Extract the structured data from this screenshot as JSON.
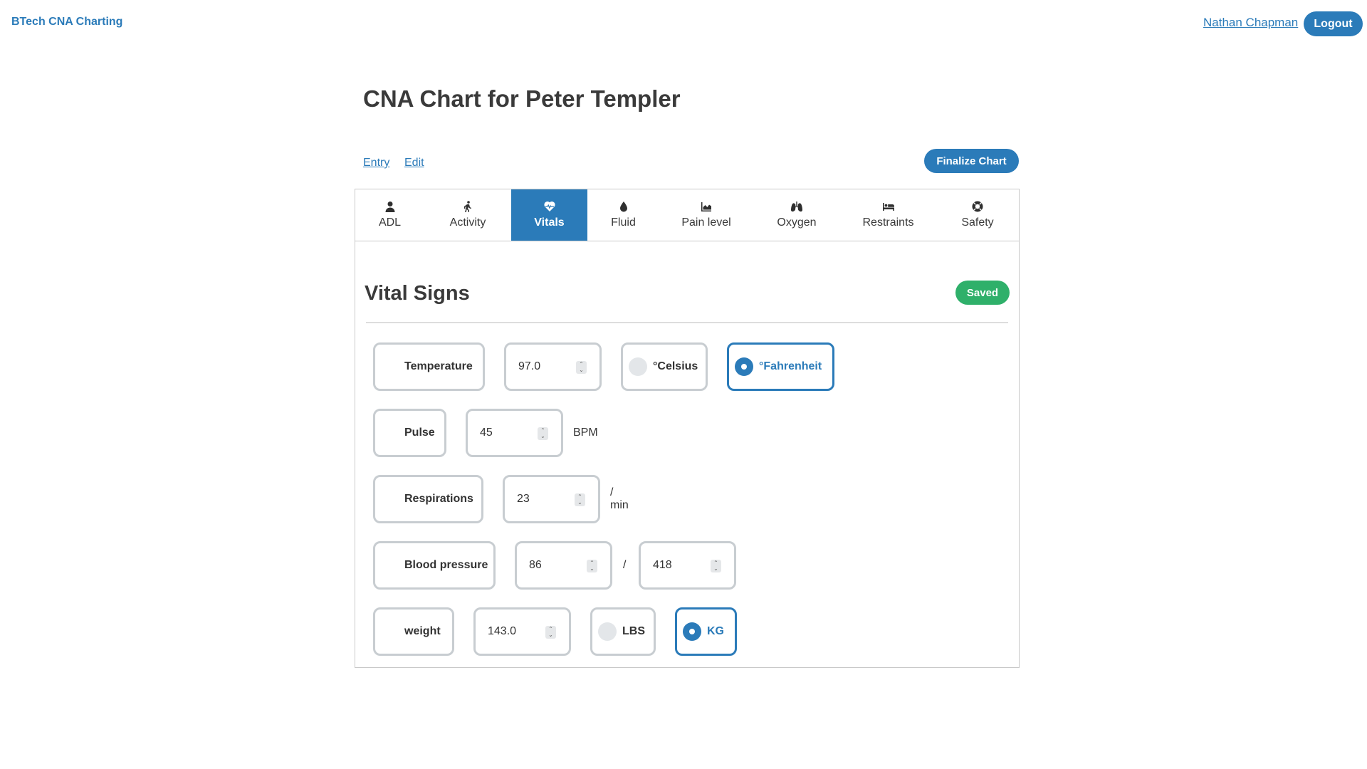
{
  "nav": {
    "brand": "BTech CNA Charting",
    "user": "Nathan Chapman",
    "logout": "Logout"
  },
  "page": {
    "title": "CNA Chart for Peter Templer"
  },
  "modes": {
    "entry": "Entry",
    "edit": "Edit"
  },
  "actions": {
    "finalize": "Finalize Chart"
  },
  "tabs": [
    {
      "label": "ADL",
      "icon": "user-icon"
    },
    {
      "label": "Activity",
      "icon": "walking-icon"
    },
    {
      "label": "Vitals",
      "icon": "heartbeat-icon",
      "active": true
    },
    {
      "label": "Fluid",
      "icon": "droplet-icon"
    },
    {
      "label": "Pain level",
      "icon": "area-chart-icon"
    },
    {
      "label": "Oxygen",
      "icon": "lungs-icon"
    },
    {
      "label": "Restraints",
      "icon": "bed-icon"
    },
    {
      "label": "Safety",
      "icon": "life-ring-icon"
    }
  ],
  "vitals": {
    "title": "Vital Signs",
    "status": "Saved",
    "temperature": {
      "label": "Temperature",
      "value": "97.0",
      "units": [
        "°Celsius",
        "°Fahrenheit"
      ],
      "selected": "°Fahrenheit"
    },
    "pulse": {
      "label": "Pulse",
      "value": "45",
      "unit": "BPM"
    },
    "respirations": {
      "label": "Respirations",
      "value": "23",
      "unit": "/ min"
    },
    "blood_pressure": {
      "label": "Blood pressure",
      "systolic": "86",
      "separator": "/",
      "diastolic": "418"
    },
    "weight": {
      "label": "weight",
      "value": "143.0",
      "units": [
        "LBS",
        "KG"
      ],
      "selected": "KG"
    }
  },
  "colors": {
    "accent": "#2b7bb9",
    "saved": "#2fb06a",
    "border": "#c8cdd1"
  }
}
